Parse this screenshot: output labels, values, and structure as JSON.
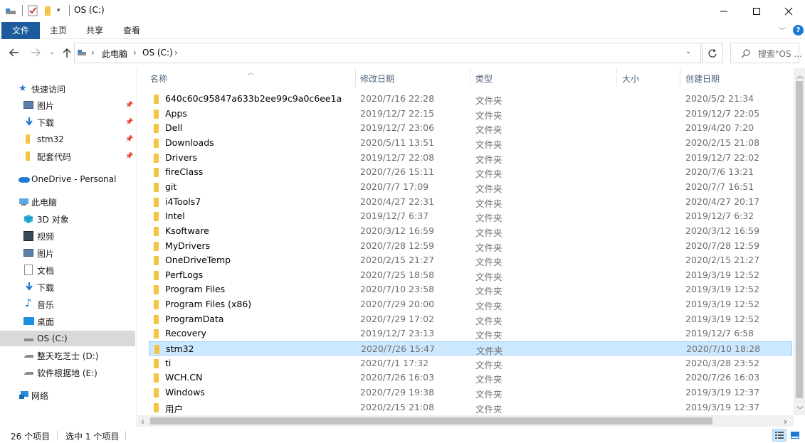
{
  "window": {
    "title": "OS (C:)",
    "minimize_icon": "minimize-icon",
    "maximize_icon": "maximize-icon",
    "close_icon": "close-icon"
  },
  "ribbon": {
    "tabs": [
      "文件",
      "主页",
      "共享",
      "查看"
    ],
    "help_icon": "help-icon"
  },
  "address": {
    "crumbs": [
      "此电脑",
      "OS (C:)"
    ],
    "search_placeholder": "搜索\"OS ..."
  },
  "nav": {
    "quick_access": "快速访问",
    "quick_items": [
      {
        "label": "图片",
        "icon": "pictures-icon",
        "pinned": true
      },
      {
        "label": "下载",
        "icon": "download-icon",
        "pinned": true
      },
      {
        "label": "stm32",
        "icon": "folder-icon",
        "pinned": true
      },
      {
        "label": "配套代码",
        "icon": "folder-icon",
        "pinned": true
      }
    ],
    "onedrive": "OneDrive - Personal",
    "this_pc": "此电脑",
    "pc_items": [
      {
        "label": "3D 对象",
        "icon": "3d-objects-icon"
      },
      {
        "label": "视频",
        "icon": "video-icon"
      },
      {
        "label": "图片",
        "icon": "pictures-icon"
      },
      {
        "label": "文档",
        "icon": "documents-icon"
      },
      {
        "label": "下载",
        "icon": "download-icon"
      },
      {
        "label": "音乐",
        "icon": "music-icon"
      },
      {
        "label": "桌面",
        "icon": "desktop-icon"
      },
      {
        "label": "OS (C:)",
        "icon": "drive-icon",
        "selected": true
      },
      {
        "label": "整天吃芝士 (D:)",
        "icon": "drive-icon"
      },
      {
        "label": "软件根据地 (E:)",
        "icon": "drive-icon"
      }
    ],
    "network": "网络"
  },
  "columns": [
    "名称",
    "修改日期",
    "类型",
    "大小",
    "创建日期"
  ],
  "files": [
    {
      "name": "640c60c95847a633b2ee99c9a0c6ee1a",
      "modified": "2020/7/16 22:28",
      "type": "文件夹",
      "created": "2020/5/2 21:34"
    },
    {
      "name": "Apps",
      "modified": "2019/12/7 22:15",
      "type": "文件夹",
      "created": "2019/12/7 22:05"
    },
    {
      "name": "Dell",
      "modified": "2019/12/7 23:06",
      "type": "文件夹",
      "created": "2019/4/20 7:20"
    },
    {
      "name": "Downloads",
      "modified": "2020/5/11 13:51",
      "type": "文件夹",
      "created": "2020/2/15 21:08"
    },
    {
      "name": "Drivers",
      "modified": "2019/12/7 22:08",
      "type": "文件夹",
      "created": "2019/12/7 22:02"
    },
    {
      "name": "fireClass",
      "modified": "2020/7/26 15:11",
      "type": "文件夹",
      "created": "2020/7/6 13:21"
    },
    {
      "name": "git",
      "modified": "2020/7/7 17:09",
      "type": "文件夹",
      "created": "2020/7/7 16:51"
    },
    {
      "name": "i4Tools7",
      "modified": "2020/4/27 22:31",
      "type": "文件夹",
      "created": "2020/4/27 20:17"
    },
    {
      "name": "Intel",
      "modified": "2019/12/7 6:37",
      "type": "文件夹",
      "created": "2019/12/7 6:32"
    },
    {
      "name": "Ksoftware",
      "modified": "2020/3/12 16:59",
      "type": "文件夹",
      "created": "2020/3/12 16:59"
    },
    {
      "name": "MyDrivers",
      "modified": "2020/7/28 12:59",
      "type": "文件夹",
      "created": "2020/7/28 12:59"
    },
    {
      "name": "OneDriveTemp",
      "modified": "2020/2/15 21:27",
      "type": "文件夹",
      "created": "2020/2/15 21:27"
    },
    {
      "name": "PerfLogs",
      "modified": "2020/7/25 18:58",
      "type": "文件夹",
      "created": "2019/3/19 12:52"
    },
    {
      "name": "Program Files",
      "modified": "2020/7/10 23:58",
      "type": "文件夹",
      "created": "2019/3/19 12:52"
    },
    {
      "name": "Program Files (x86)",
      "modified": "2020/7/29 20:00",
      "type": "文件夹",
      "created": "2019/3/19 12:52"
    },
    {
      "name": "ProgramData",
      "modified": "2020/7/29 17:02",
      "type": "文件夹",
      "created": "2019/3/19 12:52"
    },
    {
      "name": "Recovery",
      "modified": "2019/12/7 23:13",
      "type": "文件夹",
      "created": "2019/12/7 6:58"
    },
    {
      "name": "stm32",
      "modified": "2020/7/26 15:47",
      "type": "文件夹",
      "created": "2020/7/10 18:28",
      "selected": true
    },
    {
      "name": "ti",
      "modified": "2020/7/1 17:32",
      "type": "文件夹",
      "created": "2020/3/28 23:52"
    },
    {
      "name": "WCH.CN",
      "modified": "2020/7/26 16:03",
      "type": "文件夹",
      "created": "2020/7/26 16:03"
    },
    {
      "name": "Windows",
      "modified": "2020/7/29 19:38",
      "type": "文件夹",
      "created": "2019/3/19 12:37"
    },
    {
      "name": "用户",
      "modified": "2020/2/15 21:08",
      "type": "文件夹",
      "created": "2019/3/19 12:37"
    }
  ],
  "status": {
    "count": "26 个项目",
    "selected": "选中 1 个项目"
  },
  "colors": {
    "accent": "#1d5a9e",
    "selection": "#cce8ff",
    "folder": "#f4c542"
  }
}
